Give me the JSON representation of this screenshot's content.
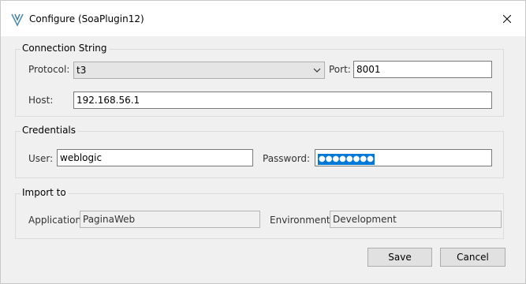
{
  "window": {
    "title": "Configure  (SoaPlugin12)"
  },
  "connection": {
    "group_title": "Connection String",
    "protocol_label": "Protocol:",
    "protocol_value": "t3",
    "port_label": "Port:",
    "port_value": "8001",
    "host_label": "Host:",
    "host_value": "192.168.56.1"
  },
  "credentials": {
    "group_title": "Credentials",
    "user_label": "User:",
    "user_value": "weblogic",
    "password_label": "Password:",
    "password_mask": "●●●●●●●●"
  },
  "import": {
    "group_title": "Import to",
    "application_label": "Application:",
    "application_value": "PaginaWeb",
    "environment_label": "Environment:",
    "environment_value": "Development"
  },
  "buttons": {
    "save": "Save",
    "cancel": "Cancel"
  },
  "icons": {
    "app": "app-logo-icon",
    "close": "close-icon",
    "dropdown": "chevron-down-icon"
  },
  "colors": {
    "selection": "#0078d7",
    "dialog_bg": "#f0f0f0"
  }
}
